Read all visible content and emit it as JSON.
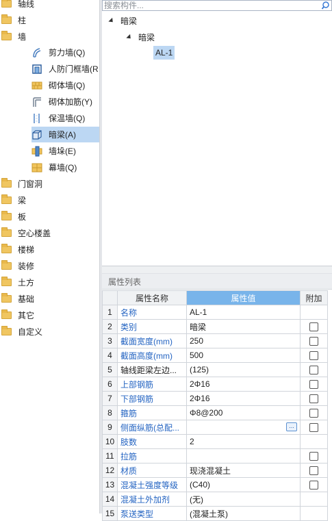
{
  "left_tree": {
    "top_items": [
      {
        "label": "轴线"
      },
      {
        "label": "柱"
      },
      {
        "label": "墙"
      }
    ],
    "wall_children": [
      {
        "label": "剪力墙(Q)",
        "icon": "shear-wall-icon"
      },
      {
        "label": "人防门框墙(R",
        "icon": "civil-defense-door-wall-icon"
      },
      {
        "label": "砌体墙(Q)",
        "icon": "masonry-wall-icon"
      },
      {
        "label": "砌体加筋(Y)",
        "icon": "masonry-reinforcement-icon"
      },
      {
        "label": "保温墙(Q)",
        "icon": "insulation-wall-icon"
      },
      {
        "label": "暗梁(A)",
        "icon": "hidden-beam-icon",
        "selected": true
      },
      {
        "label": "墙垛(E)",
        "icon": "wall-pier-icon"
      },
      {
        "label": "幕墙(Q)",
        "icon": "curtain-wall-icon"
      }
    ],
    "bottom_items": [
      {
        "label": "门窗洞"
      },
      {
        "label": "梁"
      },
      {
        "label": "板"
      },
      {
        "label": "空心楼盖"
      },
      {
        "label": "楼梯"
      },
      {
        "label": "装修"
      },
      {
        "label": "土方"
      },
      {
        "label": "基础"
      },
      {
        "label": "其它"
      },
      {
        "label": "自定义"
      }
    ]
  },
  "search": {
    "placeholder": "搜索构件..."
  },
  "component_tree": {
    "root": "暗梁",
    "child": "暗梁",
    "leaf": "AL-1"
  },
  "properties": {
    "panel_title": "属性列表",
    "headers": {
      "name": "属性名称",
      "value": "属性值",
      "extra": "附加"
    },
    "rows": [
      {
        "num": "1",
        "name": "名称",
        "value": "AL-1",
        "blue": true,
        "checkbox": false
      },
      {
        "num": "2",
        "name": "类别",
        "value": "暗梁",
        "blue": true,
        "checkbox": true
      },
      {
        "num": "3",
        "name": "截面宽度(mm)",
        "value": "250",
        "blue": true,
        "checkbox": true
      },
      {
        "num": "4",
        "name": "截面高度(mm)",
        "value": "500",
        "blue": true,
        "checkbox": true
      },
      {
        "num": "5",
        "name": "轴线距梁左边...",
        "value": "(125)",
        "blue": false,
        "checkbox": true
      },
      {
        "num": "6",
        "name": "上部钢筋",
        "value": "2Φ16",
        "blue": true,
        "checkbox": true
      },
      {
        "num": "7",
        "name": "下部钢筋",
        "value": "2Φ16",
        "blue": true,
        "checkbox": true
      },
      {
        "num": "8",
        "name": "箍筋",
        "value": "Φ8@200",
        "blue": true,
        "checkbox": true
      },
      {
        "num": "9",
        "name": "侧面纵筋(总配...",
        "value": "",
        "blue": true,
        "checkbox": true,
        "active": true,
        "button": "..."
      },
      {
        "num": "10",
        "name": "肢数",
        "value": "2",
        "blue": true,
        "checkbox": false
      },
      {
        "num": "11",
        "name": "拉筋",
        "value": "",
        "blue": true,
        "checkbox": true
      },
      {
        "num": "12",
        "name": "材质",
        "value": "现浇混凝土",
        "blue": true,
        "checkbox": true
      },
      {
        "num": "13",
        "name": "混凝土强度等级",
        "value": "(C40)",
        "blue": true,
        "checkbox": true
      },
      {
        "num": "14",
        "name": "混凝土外加剂",
        "value": "(无)",
        "blue": true,
        "checkbox": false
      },
      {
        "num": "15",
        "name": "泵送类型",
        "value": "(混凝土泵)",
        "blue": true,
        "checkbox": false
      }
    ]
  },
  "colors": {
    "selection": "#bcd7f3",
    "header_accent": "#78b4ea",
    "property_name_blue": "#2464c2"
  }
}
